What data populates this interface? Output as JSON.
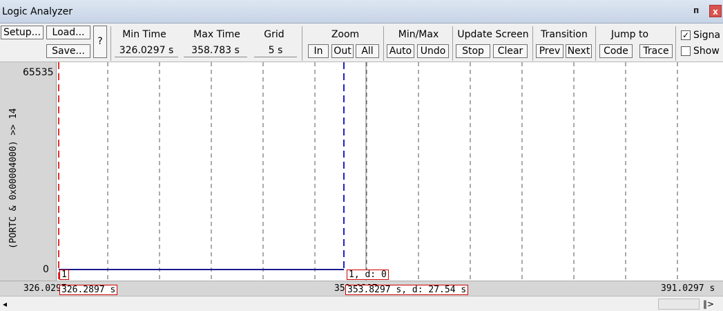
{
  "window": {
    "title": "Logic Analyzer",
    "pin_icon": "pin-icon",
    "close_icon": "close-icon",
    "close_glyph": "x",
    "pin_glyph": "ᴨ"
  },
  "toolbar": {
    "setup_label": "Setup...",
    "load_label": "Load...",
    "save_label": "Save...",
    "help_label": "?",
    "min_time": {
      "label": "Min Time",
      "value": "326.0297 s"
    },
    "max_time": {
      "label": "Max Time",
      "value": "358.783 s"
    },
    "grid": {
      "label": "Grid",
      "value": "5 s"
    },
    "zoom": {
      "label": "Zoom",
      "in": "In",
      "out": "Out",
      "all": "All"
    },
    "minmax": {
      "label": "Min/Max",
      "auto": "Auto",
      "undo": "Undo"
    },
    "update_screen": {
      "label": "Update Screen",
      "stop": "Stop",
      "clear": "Clear"
    },
    "transition": {
      "label": "Transition",
      "prev": "Prev",
      "next": "Next"
    },
    "jump_to": {
      "label": "Jump to",
      "code": "Code",
      "trace": "Trace"
    },
    "signal_info": {
      "label": "Signa",
      "checked": true,
      "check_glyph": "✓"
    },
    "show": {
      "label": "Show",
      "checked": false
    }
  },
  "plot": {
    "y_max": "65535",
    "y_min": "0",
    "signal_expression": "(PORTC & 0x00004000) >> 14",
    "signal_level": 0,
    "cursor_left": {
      "value_box": "1",
      "time_box": "326.2897 s"
    },
    "cursor_right": {
      "value_box": "1,   d: 0",
      "time_box": "353.8297 s,   d: 27.54 s"
    },
    "x_start": "326.0297",
    "x_mid": "351.0297",
    "x_end": "391.0297 s",
    "colors": {
      "left_cursor": "#e03030",
      "right_cursor": "#2020c0",
      "signal": "#1a1a8c",
      "grid": "#555555"
    }
  },
  "scrollbar": {
    "left_glyph": "◂",
    "right_glyph": "▸",
    "end_glyph": "‖>"
  }
}
